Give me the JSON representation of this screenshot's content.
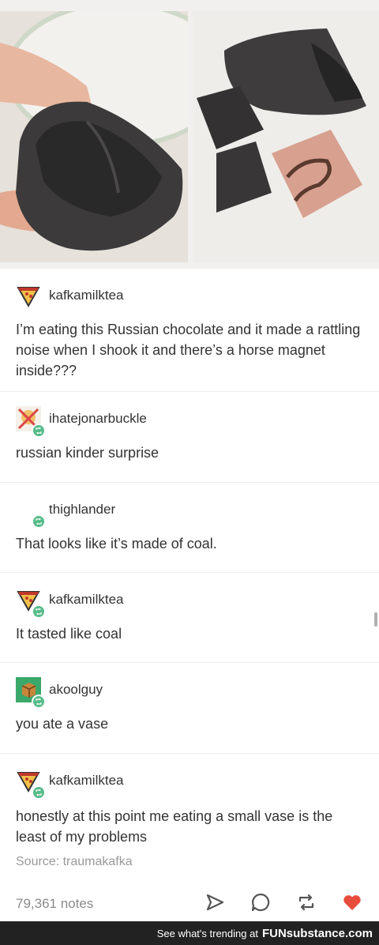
{
  "photos": [
    {
      "name": "photo-chocolate-shell-held"
    },
    {
      "name": "photo-chocolate-pieces-with-horse-magnet"
    }
  ],
  "posts": [
    {
      "username": "kafkamilktea",
      "body": "I’m eating this Russian chocolate and it made a rattling noise when I shook it and there’s a horse magnet inside???",
      "avatar": "pizza-slice-avatar",
      "reblog": false
    },
    {
      "username": "ihatejonarbuckle",
      "body": "russian kinder surprise",
      "avatar": "crossed-out-avatar",
      "reblog": true
    },
    {
      "username": "thighlander",
      "body": "That looks like it’s made of coal.",
      "avatar": "blank-avatar",
      "reblog": true
    },
    {
      "username": "kafkamilktea",
      "body": "It tasted like coal",
      "avatar": "pizza-slice-avatar",
      "reblog": true
    },
    {
      "username": "akoolguy",
      "body": "you ate a vase",
      "avatar": "cube-avatar",
      "reblog": true
    },
    {
      "username": "kafkamilktea",
      "body": "honestly at this point me eating a small vase is the least of my problems",
      "avatar": "pizza-slice-avatar",
      "reblog": true
    }
  ],
  "source": "Source: traumakafka",
  "notes": "79,361 notes",
  "actions": [
    "share-icon",
    "reply-icon",
    "reblog-icon",
    "like-icon"
  ],
  "colors": {
    "reblog_green": "#56bc8a",
    "like_red": "#e74c3c",
    "text": "#333333",
    "muted": "#999999"
  },
  "watermark": {
    "text": "See what's trending at",
    "brand": "FUNsubstance.com"
  }
}
